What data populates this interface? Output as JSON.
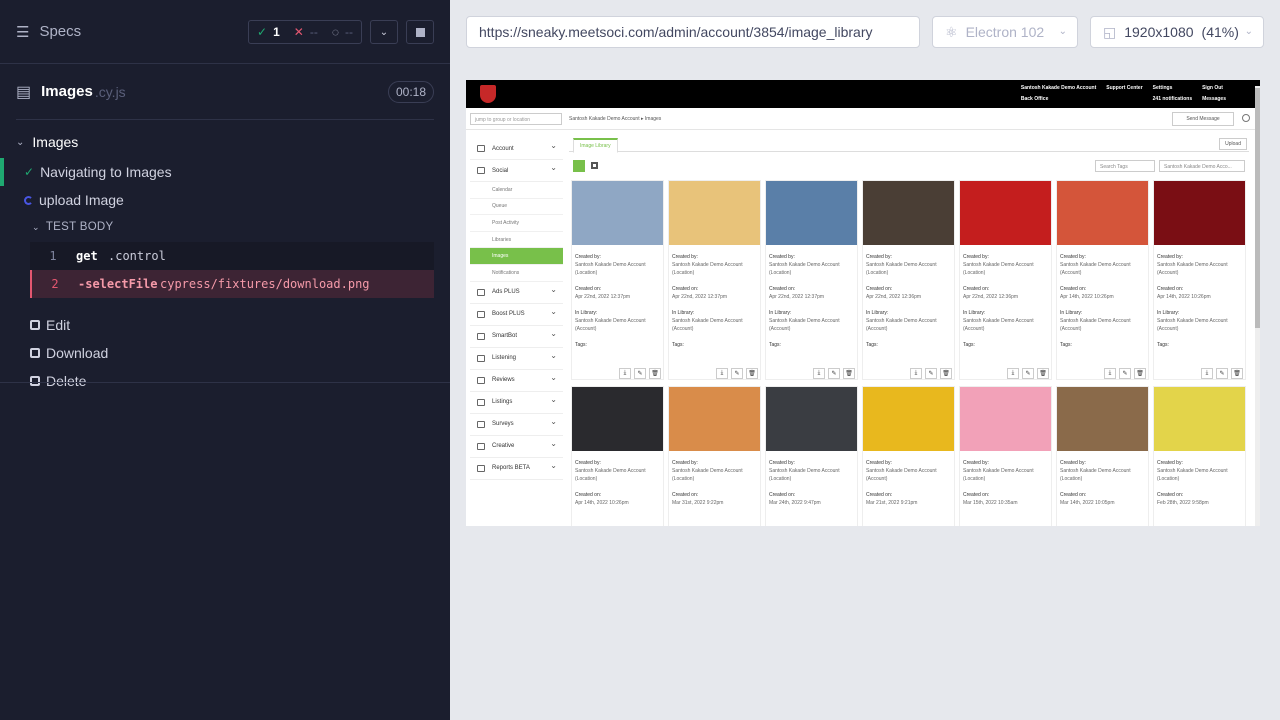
{
  "reporter": {
    "specs_label": "Specs",
    "stats": {
      "passed": "1",
      "failed": "--",
      "pending": "--"
    },
    "spec": {
      "name": "Images",
      "ext": ".cy.js",
      "duration": "00:18"
    },
    "suite_title": "Images",
    "tests": [
      {
        "title": "Navigating to Images",
        "state": "passed"
      },
      {
        "title": "upload Image",
        "state": "running"
      }
    ],
    "test_body_label": "TEST BODY",
    "commands": [
      {
        "num": "1",
        "name": "get",
        "arg": ".control"
      },
      {
        "num": "2",
        "name": "-selectFile",
        "arg": "cypress/fixtures/download.png"
      }
    ],
    "hooks": [
      "Edit",
      "Download",
      "Delete"
    ]
  },
  "aut": {
    "url": "https://sneaky.meetsoci.com/admin/account/3854/image_library",
    "browser": "Electron 102",
    "viewport": "1920x1080",
    "viewport_scale": "(41%)"
  },
  "app": {
    "topnav": [
      "Santosh Kakade Demo Account",
      "Support Center",
      "Settings",
      "Sign Out",
      "Back Office",
      "",
      "241 notifications",
      "Messages"
    ],
    "jump_placeholder": "jump to group or location",
    "breadcrumb": "Santosh Kakade Demo Account ▸ Images",
    "send_message": "Send Message",
    "sidebar": [
      {
        "label": "Account"
      },
      {
        "label": "Social",
        "children": [
          "Calendar",
          "Queue",
          "Post Activity",
          "Libraries",
          "Images",
          "Notifications"
        ]
      },
      {
        "label": "Ads PLUS"
      },
      {
        "label": "Boost PLUS"
      },
      {
        "label": "SmartBot"
      },
      {
        "label": "Listening"
      },
      {
        "label": "Reviews"
      },
      {
        "label": "Listings"
      },
      {
        "label": "Surveys"
      },
      {
        "label": "Creative"
      },
      {
        "label": "Reports BETA"
      }
    ],
    "tab_label": "Image Library",
    "upload_label": "Upload",
    "search_tags": "Search Tags",
    "account_select": "Santosh Kakade Demo Acco...",
    "meta_labels": {
      "created_by": "Created by:",
      "created_on": "Created on:",
      "in_library": "In Library:",
      "tags": "Tags:"
    },
    "images": [
      {
        "by": "Santosh Kakade Demo Account (Location)",
        "on": "Apr 22nd, 2022 12:37pm",
        "lib": "Santosh Kakade Demo Account (Account)",
        "color": "#8fa7c4"
      },
      {
        "by": "Santosh Kakade Demo Account (Location)",
        "on": "Apr 22nd, 2022 12:37pm",
        "lib": "Santosh Kakade Demo Account (Account)",
        "color": "#e8c37a"
      },
      {
        "by": "Santosh Kakade Demo Account (Location)",
        "on": "Apr 22nd, 2022 12:37pm",
        "lib": "Santosh Kakade Demo Account (Account)",
        "color": "#5a7fa8"
      },
      {
        "by": "Santosh Kakade Demo Account (Location)",
        "on": "Apr 22nd, 2022 12:36pm",
        "lib": "Santosh Kakade Demo Account (Account)",
        "color": "#4a3e35"
      },
      {
        "by": "Santosh Kakade Demo Account (Location)",
        "on": "Apr 22nd, 2022 12:36pm",
        "lib": "Santosh Kakade Demo Account (Account)",
        "color": "#c41e1e"
      },
      {
        "by": "Santosh Kakade Demo Account (Account)",
        "on": "Apr 14th, 2022 10:26pm",
        "lib": "Santosh Kakade Demo Account (Account)",
        "color": "#d4553a"
      },
      {
        "by": "Santosh Kakade Demo Account (Account)",
        "on": "Apr 14th, 2022 10:26pm",
        "lib": "Santosh Kakade Demo Account (Account)",
        "color": "#7a0e14"
      },
      {
        "by": "Santosh Kakade Demo Account (Location)",
        "on": "Apr 14th, 2022 10:26pm",
        "color": "#2a2a2e"
      },
      {
        "by": "Santosh Kakade Demo Account (Location)",
        "on": "Mar 31st, 2022 9:22pm",
        "color": "#d98c4a"
      },
      {
        "by": "Santosh Kakade Demo Account (Location)",
        "on": "Mar 24th, 2022 9:47pm",
        "color": "#3a3d42"
      },
      {
        "by": "Santosh Kakade Demo Account (Account)",
        "on": "Mar 21st, 2022 9:21pm",
        "color": "#e8b81e"
      },
      {
        "by": "Santosh Kakade Demo Account (Location)",
        "on": "Mar 15th, 2022 10:35am",
        "color": "#f2a1b8"
      },
      {
        "by": "Santosh Kakade Demo Account (Location)",
        "on": "Mar 14th, 2022 10:05pm",
        "color": "#8a6a4a"
      },
      {
        "by": "Santosh Kakade Demo Account (Location)",
        "on": "Feb 28th, 2022 9:58pm",
        "color": "#e3d44a"
      }
    ]
  }
}
